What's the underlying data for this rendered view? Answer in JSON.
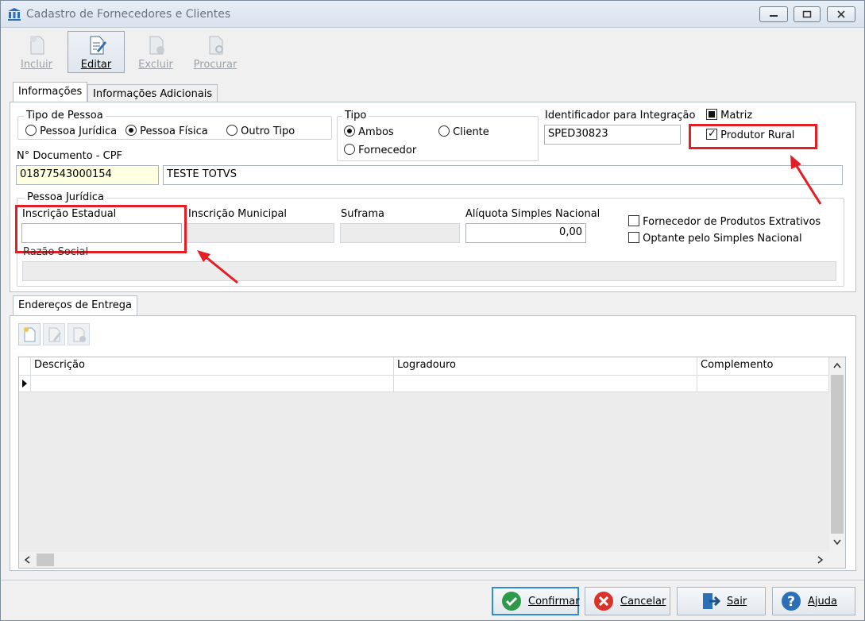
{
  "window": {
    "title": "Cadastro de Fornecedores e Clientes"
  },
  "toolbar": {
    "incluir": "Incluir",
    "editar": "Editar",
    "excluir": "Excluir",
    "procurar": "Procurar"
  },
  "tabs": {
    "informacoes": "Informações",
    "adicionais": "Informações Adicionais"
  },
  "tipo_pessoa": {
    "label": "Tipo de Pessoa",
    "options": [
      "Pessoa Jurídica",
      "Pessoa Física",
      "Outro Tipo"
    ],
    "selected": "Pessoa Física"
  },
  "tipo": {
    "label": "Tipo",
    "options": [
      "Ambos",
      "Cliente",
      "Fornecedor"
    ],
    "selected": "Ambos"
  },
  "integracao": {
    "label": "Identificador para Integração",
    "value": "SPED30823"
  },
  "matriz": {
    "label": "Matriz"
  },
  "produtor_rural": {
    "label": "Produtor Rural",
    "checked": true
  },
  "documento": {
    "label": "N° Documento - CPF",
    "value": "01877543000154",
    "nome": "TESTE TOTVS"
  },
  "pessoa_juridica": {
    "label": "Pessoa Jurídica",
    "inscricao_estadual": "Inscrição Estadual",
    "inscricao_municipal": "Inscrição Municipal",
    "suframa": "Suframa",
    "aliquota_label": "Alíquota Simples Nacional",
    "aliquota_value": "0,00",
    "razao_social": "Razão Social",
    "extrativos": "Fornecedor de Produtos Extrativos",
    "simples": "Optante pelo Simples Nacional"
  },
  "enderecos": {
    "tab": "Endereços de Entrega",
    "columns": [
      "Descrição",
      "Logradouro",
      "Complemento"
    ]
  },
  "buttons": {
    "confirmar": "Confirmar",
    "cancelar": "Cancelar",
    "sair": "Sair",
    "ajuda": "Ajuda"
  },
  "colors": {
    "highlight": "#e31e24",
    "focus": "#2f8dd6"
  }
}
